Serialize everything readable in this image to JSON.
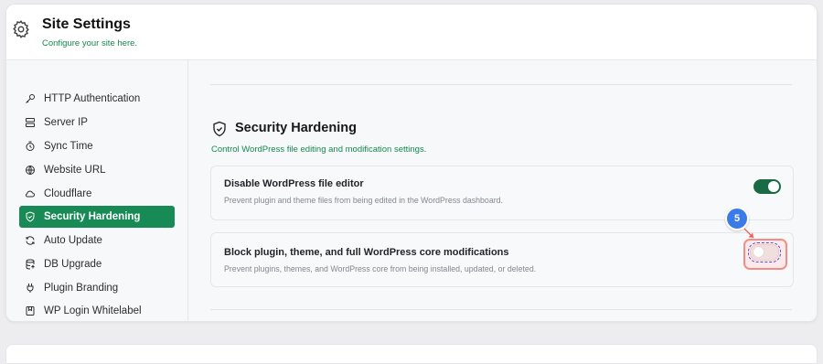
{
  "header": {
    "title": "Site Settings",
    "subtitle": "Configure your site here.",
    "icon": "gear-icon"
  },
  "sidebar": {
    "items": [
      {
        "label": "HTTP Authentication",
        "icon": "key-icon",
        "active": false
      },
      {
        "label": "Server IP",
        "icon": "server-icon",
        "active": false
      },
      {
        "label": "Sync Time",
        "icon": "clock-icon",
        "active": false
      },
      {
        "label": "Website URL",
        "icon": "globe-icon",
        "active": false
      },
      {
        "label": "Cloudflare",
        "icon": "cloud-icon",
        "active": false
      },
      {
        "label": "Security Hardening",
        "icon": "shield-icon",
        "active": true
      },
      {
        "label": "Auto Update",
        "icon": "refresh-icon",
        "active": false
      },
      {
        "label": "DB Upgrade",
        "icon": "database-icon",
        "active": false
      },
      {
        "label": "Plugin Branding",
        "icon": "plug-icon",
        "active": false
      },
      {
        "label": "WP Login Whitelabel",
        "icon": "login-icon",
        "active": false
      }
    ]
  },
  "section": {
    "title": "Security Hardening",
    "subtitle": "Control WordPress file editing and modification settings.",
    "icon": "shield-check-icon"
  },
  "settings": [
    {
      "title": "Disable WordPress file editor",
      "description": "Prevent plugin and theme files from being edited in the WordPress dashboard.",
      "enabled": true
    },
    {
      "title": "Block plugin, theme, and full WordPress core modifications",
      "description": "Prevent plugins, themes, and WordPress core from being installed, updated, or deleted.",
      "enabled": false
    }
  ],
  "annotation": {
    "step": "5"
  },
  "colors": {
    "accent": "#188a55",
    "toggle_on": "#1a6b45",
    "highlight": "#f28e8a",
    "badge": "#3b7be8"
  }
}
